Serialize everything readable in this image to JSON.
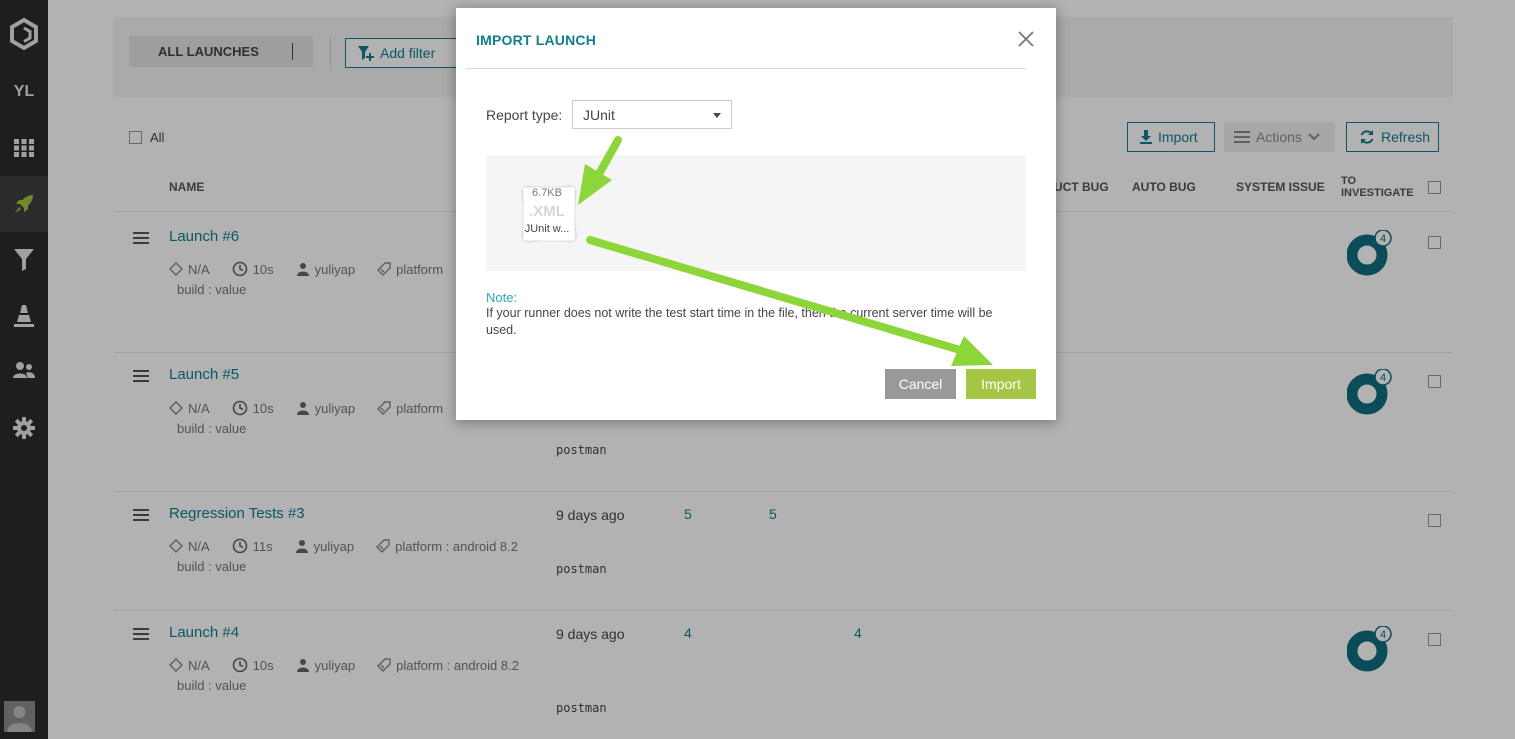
{
  "sidebar": {
    "user_initials": "YL",
    "items": [
      {
        "icon": "logo-icon"
      },
      {
        "icon": "dashboard-grid-icon"
      },
      {
        "icon": "rocket-icon",
        "active": true
      },
      {
        "icon": "filter-icon"
      },
      {
        "icon": "debug-cone-icon"
      },
      {
        "icon": "members-icon"
      },
      {
        "icon": "gear-icon"
      }
    ]
  },
  "filter_bar": {
    "all_launches": "ALL LAUNCHES",
    "add_filter": "Add filter"
  },
  "toolbar": {
    "select_all": "All",
    "import": "Import",
    "actions": "Actions",
    "refresh": "Refresh"
  },
  "columns": {
    "name": "NAME",
    "product_bug": "UCT BUG",
    "auto_bug": "AUTO BUG",
    "system_issue": "SYSTEM ISSUE",
    "to_investigate_1": "TO",
    "to_investigate_2": "INVESTIGATE"
  },
  "launches": [
    {
      "name": "Launch #6",
      "version": "N/A",
      "duration": "10s",
      "owner_user": "yuliyap",
      "attr": "platform",
      "build": "build : value",
      "time": "",
      "owner": "",
      "total": "",
      "passed": "",
      "to_investigate": "4"
    },
    {
      "name": "Launch #5",
      "version": "N/A",
      "duration": "10s",
      "owner_user": "yuliyap",
      "attr": "platform",
      "build": "build : value",
      "time": "",
      "owner": "postman",
      "total": "",
      "passed": "",
      "to_investigate": "4"
    },
    {
      "name": "Regression Tests #3",
      "version": "N/A",
      "duration": "11s",
      "owner_user": "yuliyap",
      "attr": "platform : android 8.2",
      "build": "build : value",
      "time": "9 days ago",
      "owner": "postman",
      "total": "5",
      "passed": "5",
      "to_investigate": ""
    },
    {
      "name": "Launch #4",
      "version": "N/A",
      "duration": "10s",
      "owner_user": "yuliyap",
      "attr": "platform : android 8.2",
      "build": "build : value",
      "time": "9 days ago",
      "owner": "postman",
      "total": "4",
      "passed": "4",
      "to_investigate": "4"
    }
  ],
  "modal": {
    "title": "IMPORT LAUNCH",
    "report_type_label": "Report type:",
    "report_type_value": "JUnit",
    "file": {
      "size": "6.7KB",
      "ext": ".XML",
      "name": "JUnit w..."
    },
    "note_label": "Note:",
    "note_text": "If your runner does not write the test start time in the file, then the current server time will be used.",
    "cancel": "Cancel",
    "import": "Import"
  },
  "colors": {
    "accent": "#0f7f8f",
    "import_green": "#a3c644",
    "arrow_green": "#8dd63a",
    "sidebar": "#2b2b2b"
  }
}
